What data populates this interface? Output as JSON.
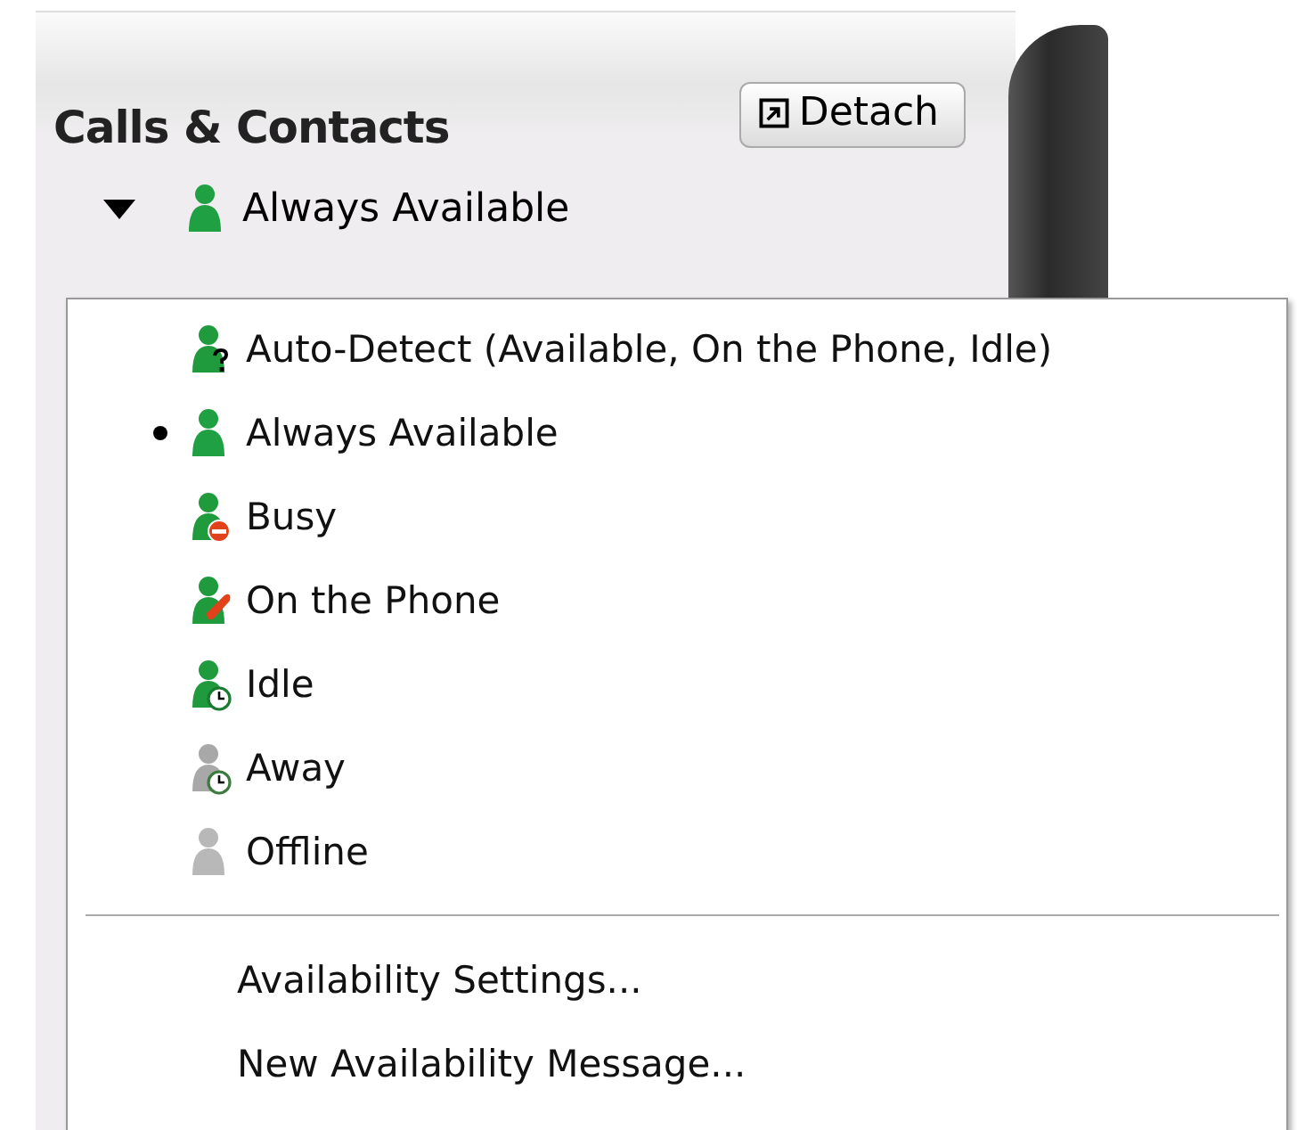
{
  "panel": {
    "title": "Calls & Contacts",
    "detach_button": "Detach"
  },
  "status_selector": {
    "kind": "available",
    "label": "Always Available",
    "expanded": true
  },
  "menu": {
    "statuses": [
      {
        "kind": "auto",
        "label": "Auto-Detect (Available, On the Phone, Idle)",
        "selected": false
      },
      {
        "kind": "available",
        "label": "Always Available",
        "selected": true
      },
      {
        "kind": "busy",
        "label": "Busy",
        "selected": false
      },
      {
        "kind": "phone",
        "label": "On the Phone",
        "selected": false
      },
      {
        "kind": "idle",
        "label": "Idle",
        "selected": false
      },
      {
        "kind": "away",
        "label": "Away",
        "selected": false
      },
      {
        "kind": "offline",
        "label": "Offline",
        "selected": false
      }
    ],
    "actions": [
      "Availability Settings...",
      "New Availability Message..."
    ]
  }
}
